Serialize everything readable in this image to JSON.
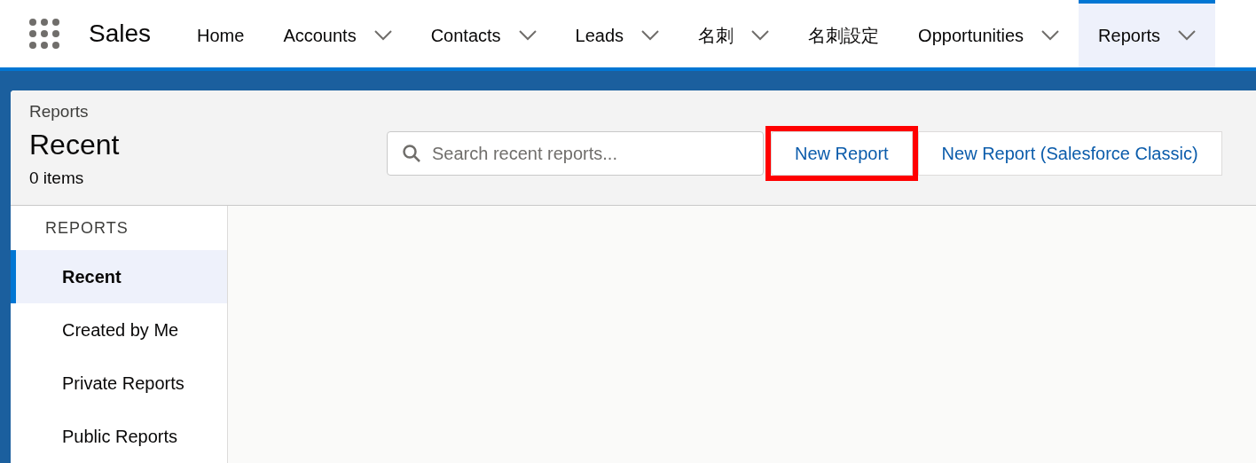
{
  "app": {
    "name": "Sales"
  },
  "nav_items": [
    {
      "label": "Home",
      "has_menu": false,
      "selected": false
    },
    {
      "label": "Accounts",
      "has_menu": true,
      "selected": false
    },
    {
      "label": "Contacts",
      "has_menu": true,
      "selected": false
    },
    {
      "label": "Leads",
      "has_menu": true,
      "selected": false
    },
    {
      "label": "名刺",
      "has_menu": true,
      "selected": false
    },
    {
      "label": "名刺設定",
      "has_menu": false,
      "selected": false
    },
    {
      "label": "Opportunities",
      "has_menu": true,
      "selected": false
    },
    {
      "label": "Reports",
      "has_menu": true,
      "selected": true
    }
  ],
  "header": {
    "breadcrumb": "Reports",
    "title": "Recent",
    "count": "0 items"
  },
  "search": {
    "placeholder": "Search recent reports..."
  },
  "buttons": [
    {
      "label": "New Report",
      "highlighted": true
    },
    {
      "label": "New Report (Salesforce Classic)",
      "highlighted": false
    }
  ],
  "sidebar": {
    "heading": "REPORTS",
    "items": [
      {
        "label": "Recent",
        "selected": true
      },
      {
        "label": "Created by Me",
        "selected": false
      },
      {
        "label": "Private Reports",
        "selected": false
      },
      {
        "label": "Public Reports",
        "selected": false
      }
    ]
  }
}
